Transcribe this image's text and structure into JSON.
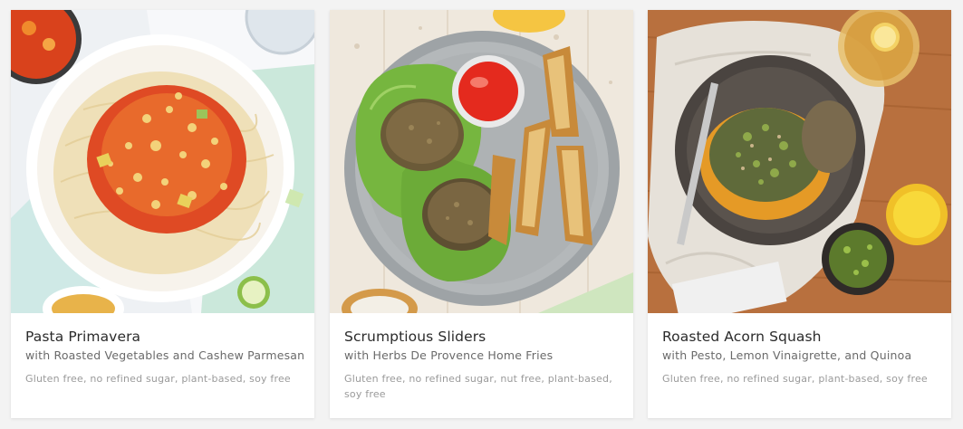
{
  "cards": [
    {
      "title": "Pasta Primavera",
      "subtitle": "with Roasted Vegetables and Cashew Parmesan",
      "tags": "Gluten free, no refined sugar, plant-based, soy free",
      "image_icon": "pasta-dish-photo"
    },
    {
      "title": "Scrumptious Sliders",
      "subtitle": "with Herbs De Provence Home Fries",
      "tags": "Gluten free, no refined sugar, nut free, plant-based, soy free",
      "image_icon": "sliders-dish-photo"
    },
    {
      "title": "Roasted Acorn Squash",
      "subtitle": "with Pesto, Lemon Vinaigrette, and Quinoa",
      "tags": "Gluten free, no refined sugar, plant-based, soy free",
      "image_icon": "squash-dish-photo"
    }
  ],
  "colors": {
    "page_bg": "#f3f3f3",
    "card_bg": "#ffffff",
    "title": "#2b2b2b",
    "subtitle": "#6a6a6a",
    "tags": "#9a9a9a"
  }
}
